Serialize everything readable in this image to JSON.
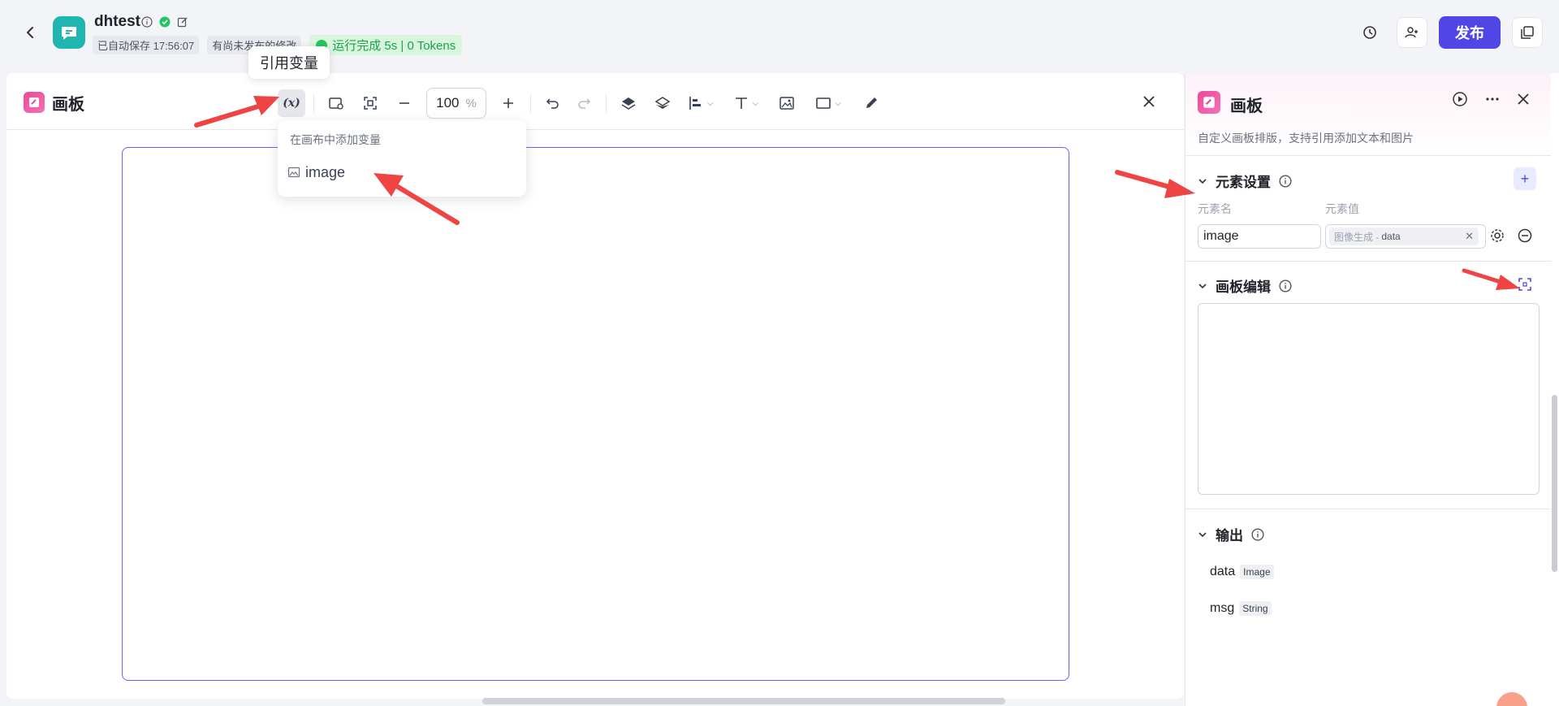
{
  "header": {
    "app_name": "dhtest",
    "autosave": "已自动保存 17:56:07",
    "unpublished": "有尚未发布的修改",
    "run_status": "运行完成 5s | 0 Tokens",
    "publish_label": "发布"
  },
  "tooltip": {
    "text": "引用变量"
  },
  "canvas": {
    "title": "画板",
    "zoom_value": "100",
    "zoom_unit": "%",
    "toolbar_icons": [
      "variable-icon",
      "add-image-icon",
      "fit-view-icon",
      "zoom-out-icon",
      "zoom-in-icon",
      "undo-icon",
      "redo-icon",
      "bring-front-icon",
      "send-back-icon",
      "align-icon",
      "text-icon",
      "image-icon",
      "rectangle-icon",
      "pencil-icon"
    ]
  },
  "dropdown": {
    "title": "在画布中添加变量",
    "items": [
      {
        "label": "image",
        "icon": "image-icon"
      }
    ]
  },
  "right_panel": {
    "title": "画板",
    "description": "自定义画板排版，支持引用添加文本和图片",
    "element_settings": {
      "title": "元素设置",
      "name_col": "元素名",
      "value_col": "元素值",
      "name_value": "image",
      "value_source": "图像生成 -",
      "value_field": "data"
    },
    "canvas_edit": {
      "title": "画板编辑"
    },
    "output": {
      "title": "输出",
      "items": [
        {
          "name": "data",
          "type": "Image"
        },
        {
          "name": "msg",
          "type": "String"
        }
      ]
    }
  },
  "colors": {
    "primary": "#4f46e5",
    "success": "#22c55e",
    "canvas_border": "#6366f1",
    "annotation_arrow": "#ef4444"
  }
}
